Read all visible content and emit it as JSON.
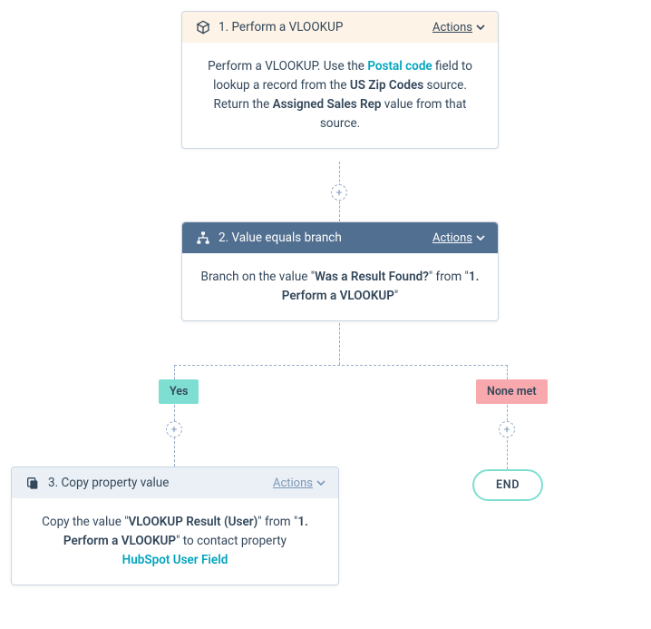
{
  "cards": {
    "vlookup": {
      "title": "1. Perform a VLOOKUP",
      "actions_label": "Actions",
      "body_pre": "Perform a VLOOKUP. Use the ",
      "field": "Postal code",
      "body_mid1": " field to lookup a record from the ",
      "source": "US Zip Codes",
      "body_mid2": " source. Return the ",
      "return_col": "Assigned Sales Rep",
      "body_post": " value from that source."
    },
    "branch": {
      "title": "2. Value equals branch",
      "actions_label": "Actions",
      "body_pre": "Branch on the value \"",
      "condition": "Was a Result Found?",
      "body_mid": "\" from \"",
      "from_step": "1. Perform a VLOOKUP",
      "body_post": "\""
    },
    "copy": {
      "title": "3. Copy property value",
      "actions_label": "Actions",
      "body_pre": "Copy the value \"",
      "value": "VLOOKUP Result (User)",
      "body_mid": "\" from \"",
      "from_step": "1. Perform a VLOOKUP",
      "body_mid2": "\" to contact property ",
      "target": "HubSpot User Field"
    }
  },
  "branches": {
    "yes": "Yes",
    "none": "None met"
  },
  "end_label": "END",
  "plus_glyph": "+"
}
